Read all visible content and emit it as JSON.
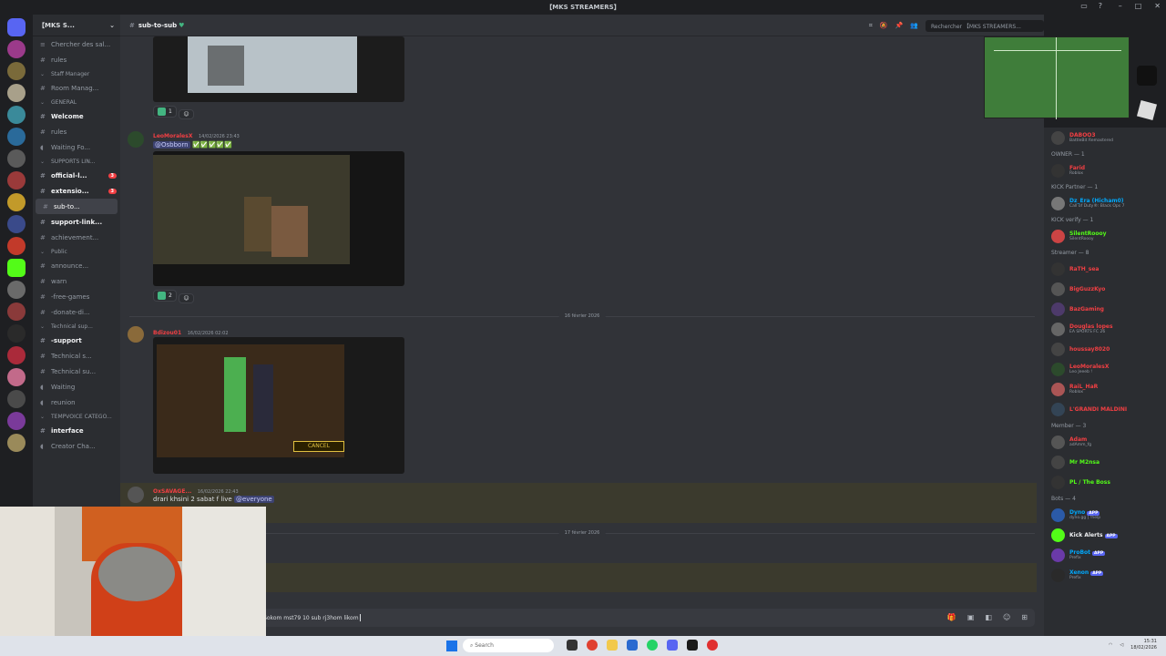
{
  "window": {
    "title": "【MKS STREAMERS】"
  },
  "server": {
    "name": "【MKS S..."
  },
  "channel": {
    "name": "sub-to-sub"
  },
  "search": {
    "placeholder": "Rechercher 【MKS STREAMERS..."
  },
  "sidebar": {
    "search_channels": "Chercher des sal...",
    "items": [
      {
        "label": "rules",
        "type": "channel"
      },
      {
        "label": "Staff Manager",
        "type": "category"
      },
      {
        "label": "Room Manag...",
        "type": "channel"
      },
      {
        "label": "GENERAL",
        "type": "category"
      },
      {
        "label": "Welcome",
        "type": "channel-bold"
      },
      {
        "label": "rules",
        "type": "channel"
      },
      {
        "label": "Waiting Fo...",
        "type": "voice"
      },
      {
        "label": "SUPPORTS LIN...",
        "type": "category"
      },
      {
        "label": "official-l...",
        "type": "channel-bold",
        "badge": "3"
      },
      {
        "label": "extensio...",
        "type": "channel-bold",
        "badge": "3"
      },
      {
        "label": "sub-to...",
        "type": "channel-active"
      },
      {
        "label": "support-link...",
        "type": "channel-bold"
      },
      {
        "label": "achievement...",
        "type": "channel"
      },
      {
        "label": "Public",
        "type": "category"
      },
      {
        "label": "announce...",
        "type": "channel"
      },
      {
        "label": "warn",
        "type": "channel"
      },
      {
        "label": "-free-games",
        "type": "channel"
      },
      {
        "label": "-donate-di...",
        "type": "channel"
      },
      {
        "label": "Technical sup...",
        "type": "category"
      },
      {
        "label": "-support",
        "type": "channel-bold"
      },
      {
        "label": "Technical s...",
        "type": "channel"
      },
      {
        "label": "Technical su...",
        "type": "channel"
      },
      {
        "label": "Waiting",
        "type": "voice"
      },
      {
        "label": "reunion",
        "type": "voice"
      },
      {
        "label": "TEMPVOICE CATEGO...",
        "type": "category"
      },
      {
        "label": "interface",
        "type": "channel-bold"
      },
      {
        "label": "Creator Cha...",
        "type": "voice"
      }
    ]
  },
  "messages": [
    {
      "reactions": [
        {
          "count": "1"
        }
      ]
    },
    {
      "author": "LeoMoralesX",
      "timestamp": "14/02/2026 23:43",
      "mention": "@Osbborn",
      "reactions": [
        {
          "count": "2"
        }
      ]
    },
    {
      "date_divider": "16 février 2026"
    },
    {
      "author": "Bdizou01",
      "timestamp": "16/02/2026 02:02",
      "embed_button": "CANCEL"
    },
    {
      "author": "OxSAVAGE...",
      "timestamp": "16/02/2026 22:43",
      "text": "drari khsini 2 sabat f live",
      "mention": "@everyone"
    },
    {
      "date_divider": "17 février 2026"
    }
  ],
  "composer": {
    "text": "mes kol Sokom mst79 10 sub rj3hom likom"
  },
  "members": [
    {
      "group": "",
      "name": "DABOO3",
      "sub": "BattleBit Remastered",
      "color": "#f23f43",
      "av": "#444"
    },
    {
      "group": "OWNER — 1",
      "name": "Farid",
      "sub": "Roblox",
      "color": "#f23f43",
      "av": "#333"
    },
    {
      "group": "KICK Partner — 1",
      "name": "Dz_Era (Hicham0)",
      "sub": "Call of Duty®: Black Ops 7",
      "color": "#00a8fc",
      "av": "#777"
    },
    {
      "group": "KICK verify — 1",
      "name": "SilentRoooy",
      "sub": "SilentRoooy",
      "color": "#53fc18",
      "av": "#c44"
    },
    {
      "group": "Streamer — 8",
      "name": "RaTH_sea",
      "sub": "",
      "color": "#f23f43",
      "av": "#333"
    },
    {
      "group": "",
      "name": "BigGuzzKyo",
      "sub": "",
      "color": "#f23f43",
      "av": "#555"
    },
    {
      "group": "",
      "name": "BazGaming",
      "sub": "",
      "color": "#f23f43",
      "av": "#4d3a6a"
    },
    {
      "group": "",
      "name": "Douglas lopes",
      "sub": "EA SPORTS FC 26",
      "color": "#f23f43",
      "av": "#666"
    },
    {
      "group": "",
      "name": "houssay8020",
      "sub": "",
      "color": "#f23f43",
      "av": "#444"
    },
    {
      "group": "",
      "name": "LeoMoralesX",
      "sub": "Leo Jeeeb !",
      "color": "#f23f43",
      "av": "#2c4a2c"
    },
    {
      "group": "",
      "name": "RaiL_HaR",
      "sub": "Roblox",
      "color": "#f23f43",
      "av": "#a55"
    },
    {
      "group": "",
      "name": "L'GRANDI MALDINI",
      "sub": "",
      "color": "#f23f43",
      "av": "#345"
    },
    {
      "group": "Member — 3",
      "name": "Adam",
      "sub": "adAmm_fg",
      "color": "#f23f43",
      "av": "#555"
    },
    {
      "group": "",
      "name": "Mr M2nsa",
      "sub": "",
      "color": "#53fc18",
      "av": "#444"
    },
    {
      "group": "",
      "name": "PL / The Boss",
      "sub": "",
      "color": "#53fc18",
      "av": "#333"
    },
    {
      "group": "Bots — 4",
      "name": "Dyno",
      "sub": "dyno.gg | !help",
      "color": "#00a8fc",
      "av": "#2b5aa8",
      "app": "APP"
    },
    {
      "group": "",
      "name": "Kick Alerts",
      "sub": "",
      "color": "#f2f3f5",
      "av": "#53fc18",
      "app": "APP"
    },
    {
      "group": "",
      "name": "ProBot",
      "sub": "Prefix",
      "color": "#00a8fc",
      "av": "#6a3aa8",
      "app": "APP"
    },
    {
      "group": "",
      "name": "Xenon",
      "sub": "Prefix",
      "color": "#00a8fc",
      "av": "#2a2a2a",
      "app": "APP"
    }
  ],
  "taskbar": {
    "search": "Search",
    "time": "15:31",
    "date": "18/02/2026"
  },
  "colors": {
    "accent": "#5865f2",
    "online": "#43b581",
    "kick": "#53fc18"
  }
}
